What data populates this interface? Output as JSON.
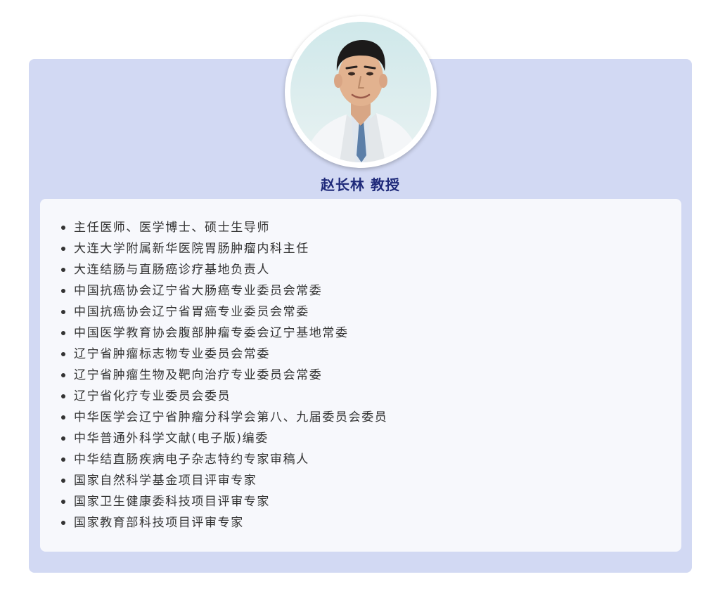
{
  "profile": {
    "name": "赵长林 教授",
    "credentials": [
      "主任医师、医学博士、硕士生导师",
      "大连大学附属新华医院胃肠肿瘤内科主任",
      "大连结肠与直肠癌诊疗基地负责人",
      "中国抗癌协会辽宁省大肠癌专业委员会常委",
      "中国抗癌协会辽宁省胃癌专业委员会常委",
      "中国医学教育协会腹部肿瘤专委会辽宁基地常委",
      "辽宁省肿瘤标志物专业委员会常委",
      "辽宁省肿瘤生物及靶向治疗专业委员会常委",
      "辽宁省化疗专业委员会委员",
      "中华医学会辽宁省肿瘤分科学会第八、九届委员会委员",
      "中华普通外科学文献(电子版)编委",
      "中华结直肠疾病电子杂志特约专家审稿人",
      "国家自然科学基金项目评审专家",
      "国家卫生健康委科技项目评审专家",
      "国家教育部科技项目评审专家"
    ]
  },
  "colors": {
    "card_bg": "#d2d9f3",
    "inner_bg": "#f7f8fc",
    "name_color": "#1f2a7a",
    "text_color": "#333333"
  },
  "icons": {
    "avatar": "doctor-portrait"
  }
}
